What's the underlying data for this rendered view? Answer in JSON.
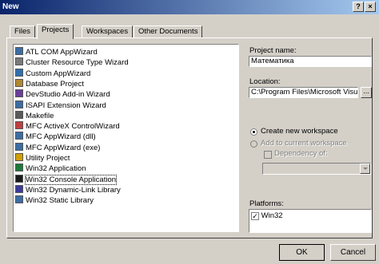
{
  "window": {
    "title": "New"
  },
  "titlebar_buttons": {
    "help": "?",
    "close": "×"
  },
  "tabs": [
    "Files",
    "Projects",
    "Workspaces",
    "Other Documents"
  ],
  "active_tab": "Projects",
  "project_types": [
    {
      "label": "ATL COM AppWizard",
      "icon": "atl-icon"
    },
    {
      "label": "Cluster Resource Type Wizard",
      "icon": "cluster-icon"
    },
    {
      "label": "Custom AppWizard",
      "icon": "custom-wizard-icon"
    },
    {
      "label": "Database Project",
      "icon": "database-icon"
    },
    {
      "label": "DevStudio Add-in Wizard",
      "icon": "addin-icon"
    },
    {
      "label": "ISAPI Extension Wizard",
      "icon": "isapi-icon"
    },
    {
      "label": "Makefile",
      "icon": "makefile-icon"
    },
    {
      "label": "MFC ActiveX ControlWizard",
      "icon": "activex-icon"
    },
    {
      "label": "MFC AppWizard (dll)",
      "icon": "mfc-dll-icon"
    },
    {
      "label": "MFC AppWizard (exe)",
      "icon": "mfc-exe-icon"
    },
    {
      "label": "Utility Project",
      "icon": "utility-icon"
    },
    {
      "label": "Win32 Application",
      "icon": "win32-app-icon"
    },
    {
      "label": "Win32 Console Application",
      "icon": "console-icon",
      "selected": true
    },
    {
      "label": "Win32 Dynamic-Link Library",
      "icon": "dll-icon"
    },
    {
      "label": "Win32 Static Library",
      "icon": "lib-icon"
    }
  ],
  "project_name": {
    "label": "Project name:",
    "value": "Математика"
  },
  "location": {
    "label": "Location:",
    "value": "C:\\Program Files\\Microsoft Visua",
    "browse": "..."
  },
  "workspace": {
    "create_label": "Create new workspace",
    "add_label": "Add to current workspace",
    "dependency_label": "Dependency of:",
    "dependency_value": ""
  },
  "platforms": {
    "label": "Platforms:",
    "items": [
      {
        "label": "Win32",
        "checked": true
      }
    ]
  },
  "buttons": {
    "ok": "OK",
    "cancel": "Cancel"
  },
  "colors": {
    "title_start": "#0a246a",
    "title_end": "#a6caf0",
    "face": "#d4d0c8"
  }
}
